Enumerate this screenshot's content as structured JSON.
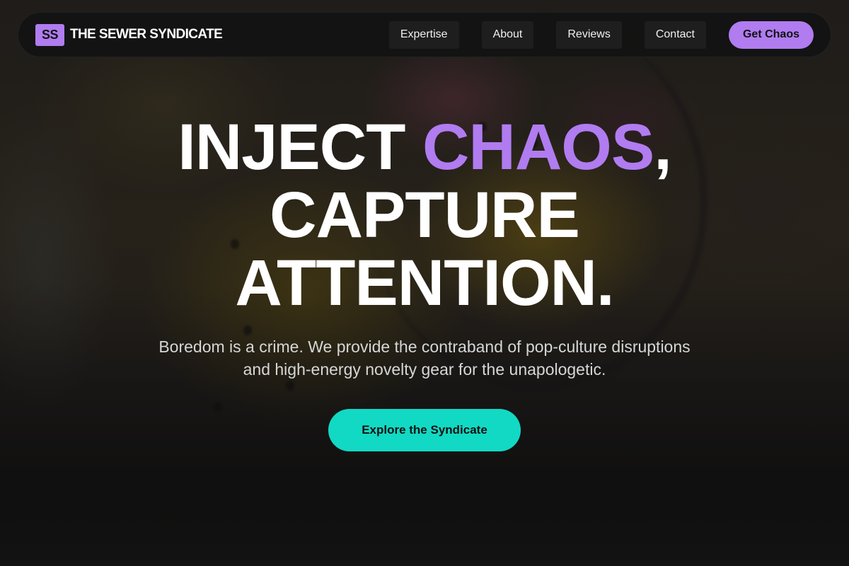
{
  "brand": {
    "mark": "SS",
    "name": "THE SEWER SYNDICATE"
  },
  "nav": {
    "links": [
      "Expertise",
      "About",
      "Reviews",
      "Contact"
    ],
    "cta_label": "Get Chaos"
  },
  "hero": {
    "headline_part1": "INJECT ",
    "headline_accent": "CHAOS",
    "headline_comma": ",",
    "headline_line2": "CAPTURE",
    "headline_line3": "ATTENTION.",
    "subhead_line1": "Boredom is a crime. We provide the contraband of pop-culture disruptions",
    "subhead_line2": "and high-energy novelty gear for the unapologetic.",
    "cta_label": "Explore the Syndicate"
  },
  "colors": {
    "accent_purple": "#b07cf0",
    "accent_teal": "#12d9c4",
    "nav_background": "#121212"
  }
}
